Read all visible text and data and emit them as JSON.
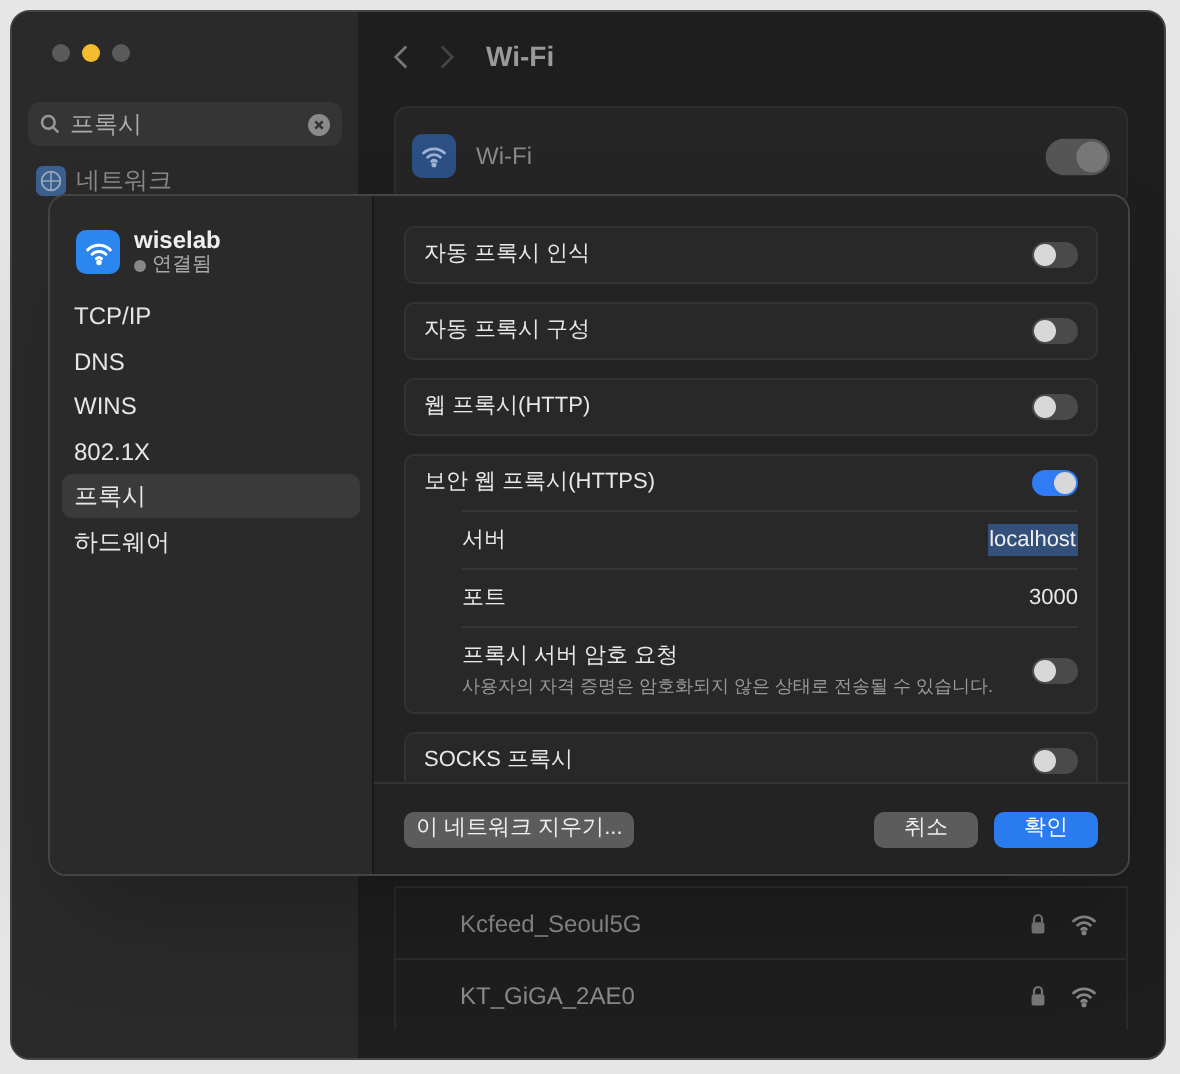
{
  "window": {
    "title": "Wi-Fi",
    "search": {
      "value": "프록시"
    },
    "sidebar_items": [
      {
        "label": "네트워크"
      }
    ],
    "wifi": {
      "label": "Wi-Fi",
      "on": true
    },
    "networks": [
      {
        "name": "Kcfeed_Seoul5G",
        "locked": true
      },
      {
        "name": "KT_GiGA_2AE0",
        "locked": true
      }
    ]
  },
  "sheet": {
    "network": {
      "name": "wiselab",
      "status": "연결됨"
    },
    "tabs": [
      {
        "label": "TCP/IP",
        "selected": false
      },
      {
        "label": "DNS",
        "selected": false
      },
      {
        "label": "WINS",
        "selected": false
      },
      {
        "label": "802.1X",
        "selected": false
      },
      {
        "label": "프록시",
        "selected": true
      },
      {
        "label": "하드웨어",
        "selected": false
      }
    ],
    "proxies": [
      {
        "label": "자동 프록시 인식",
        "on": false
      },
      {
        "label": "자동 프록시 구성",
        "on": false
      },
      {
        "label": "웹 프록시(HTTP)",
        "on": false
      },
      {
        "label": "보안 웹 프록시(HTTPS)",
        "on": true,
        "server": {
          "label": "서버",
          "value": "localhost"
        },
        "port": {
          "label": "포트",
          "value": "3000"
        },
        "password": {
          "label": "프록시 서버 암호 요청",
          "note": "사용자의 자격 증명은 암호화되지 않은 상태로 전송될 수 있습니다.",
          "on": false
        }
      },
      {
        "label": "SOCKS 프록시",
        "on": false
      }
    ],
    "buttons": {
      "forget": "이 네트워크 지우기...",
      "cancel": "취소",
      "ok": "확인"
    }
  }
}
